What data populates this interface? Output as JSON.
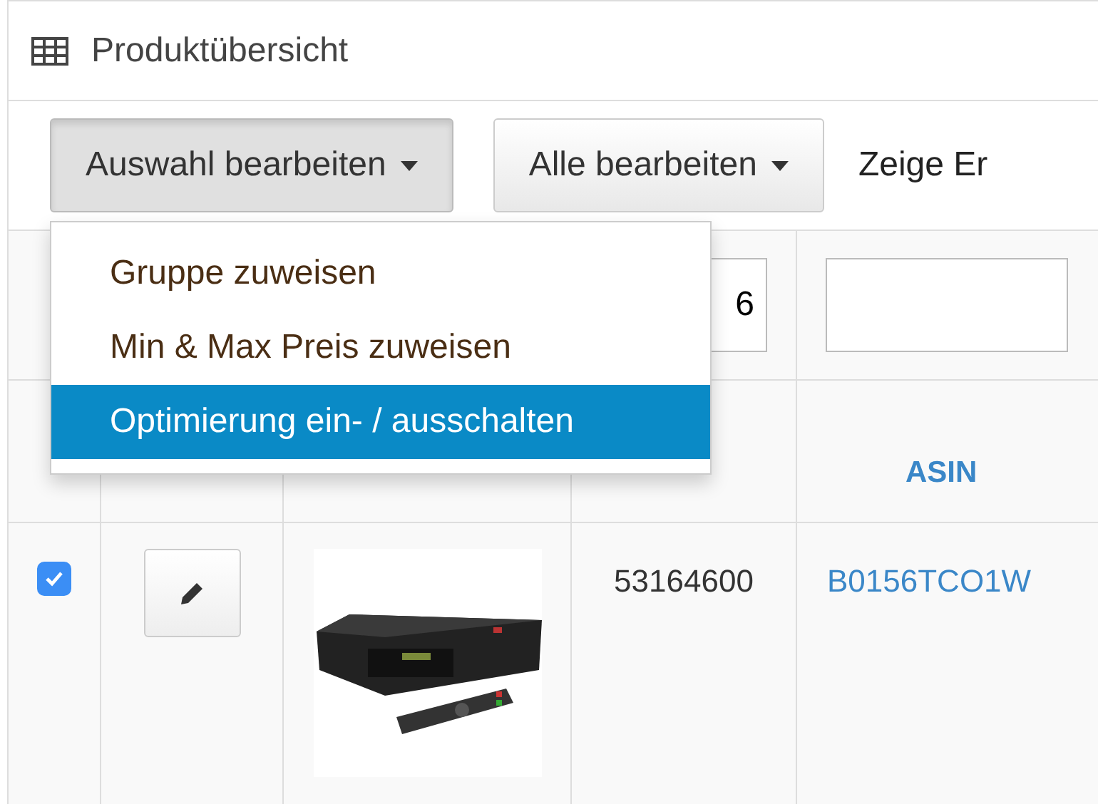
{
  "panel": {
    "title": "Produktübersicht"
  },
  "toolbar": {
    "buttons": [
      {
        "label": "Auswahl bearbeiten",
        "active": true
      },
      {
        "label": "Alle bearbeiten",
        "active": false
      }
    ],
    "info": "Zeige Er"
  },
  "menu": {
    "items": [
      {
        "label": "Gruppe zuweisen",
        "selected": false
      },
      {
        "label": "Min & Max Preis zuweisen",
        "selected": false
      },
      {
        "label": "Optimierung ein- / ausschalten",
        "selected": true
      }
    ]
  },
  "filters": {
    "sku": "6"
  },
  "table": {
    "columns": [
      {
        "label": "ASIN"
      }
    ],
    "rows": [
      {
        "checked": true,
        "sku": "53164600",
        "asin": "B0156TCO1W"
      }
    ]
  }
}
